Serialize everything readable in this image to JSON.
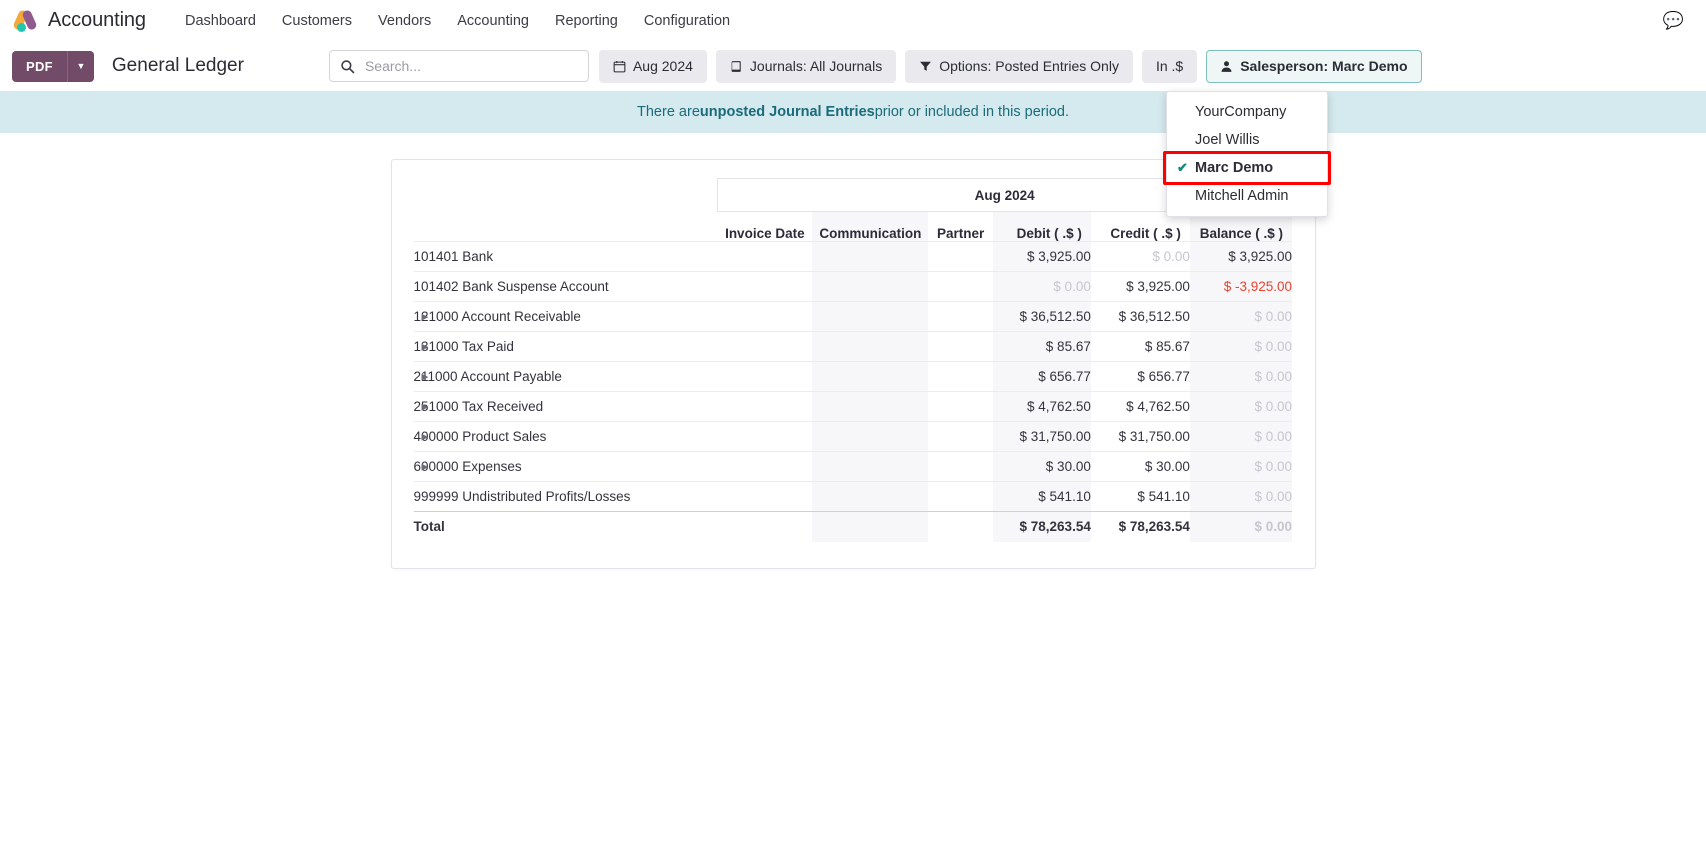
{
  "navbar": {
    "brand": "Accounting",
    "links": [
      "Dashboard",
      "Customers",
      "Vendors",
      "Accounting",
      "Reporting",
      "Configuration"
    ],
    "right_icons": [
      "chat-icon"
    ]
  },
  "toolbar": {
    "pdf_label": "PDF",
    "report_title": "General Ledger",
    "search_placeholder": "Search...",
    "search_value": "",
    "filters": [
      {
        "label": "Aug 2024",
        "icon": "calendar-icon",
        "active": false
      },
      {
        "label": "Journals: All Journals",
        "icon": "book-icon",
        "active": false
      },
      {
        "label": "Options: Posted Entries Only",
        "icon": "funnel-icon",
        "active": false
      },
      {
        "label": "In .$",
        "icon": "",
        "active": false
      },
      {
        "label": "Salesperson: Marc Demo",
        "icon": "person-icon",
        "active": true
      }
    ]
  },
  "dropdown": {
    "items": [
      {
        "label": "YourCompany",
        "selected": false,
        "highlighted": false
      },
      {
        "label": "Joel Willis",
        "selected": false,
        "highlighted": false
      },
      {
        "label": "Marc Demo",
        "selected": true,
        "highlighted": true
      },
      {
        "label": "Mitchell Admin",
        "selected": false,
        "highlighted": false
      }
    ],
    "highlight_color": "#ff0000",
    "check_glyph": "✔"
  },
  "alert": {
    "prefix": "There are ",
    "bold": "unposted Journal Entries",
    "suffix": " prior or included in this period."
  },
  "report": {
    "period_label": "Aug 2024",
    "columns": [
      "Invoice Date",
      "Communication",
      "Partner",
      "Debit ( .$ )",
      "Credit ( .$ )",
      "Balance ( .$ )"
    ],
    "rows": [
      {
        "name": "101401 Bank",
        "expandable": false,
        "invoice_date": "",
        "communication": "",
        "partner": "",
        "debit": "$ 3,925.00",
        "credit": "$ 0.00",
        "balance": "$ 3,925.00",
        "debit_muted": false,
        "credit_muted": true,
        "balance_muted": false,
        "balance_negative": false
      },
      {
        "name": "101402 Bank Suspense Account",
        "expandable": false,
        "invoice_date": "",
        "communication": "",
        "partner": "",
        "debit": "$ 0.00",
        "credit": "$ 3,925.00",
        "balance": "$ -3,925.00",
        "debit_muted": true,
        "credit_muted": false,
        "balance_muted": false,
        "balance_negative": true
      },
      {
        "name": "121000 Account Receivable",
        "expandable": true,
        "invoice_date": "",
        "communication": "",
        "partner": "",
        "debit": "$ 36,512.50",
        "credit": "$ 36,512.50",
        "balance": "$ 0.00",
        "debit_muted": false,
        "credit_muted": false,
        "balance_muted": true,
        "balance_negative": false
      },
      {
        "name": "131000 Tax Paid",
        "expandable": true,
        "invoice_date": "",
        "communication": "",
        "partner": "",
        "debit": "$ 85.67",
        "credit": "$ 85.67",
        "balance": "$ 0.00",
        "debit_muted": false,
        "credit_muted": false,
        "balance_muted": true,
        "balance_negative": false
      },
      {
        "name": "211000 Account Payable",
        "expandable": true,
        "invoice_date": "",
        "communication": "",
        "partner": "",
        "debit": "$ 656.77",
        "credit": "$ 656.77",
        "balance": "$ 0.00",
        "debit_muted": false,
        "credit_muted": false,
        "balance_muted": true,
        "balance_negative": false
      },
      {
        "name": "251000 Tax Received",
        "expandable": true,
        "invoice_date": "",
        "communication": "",
        "partner": "",
        "debit": "$ 4,762.50",
        "credit": "$ 4,762.50",
        "balance": "$ 0.00",
        "debit_muted": false,
        "credit_muted": false,
        "balance_muted": true,
        "balance_negative": false
      },
      {
        "name": "400000 Product Sales",
        "expandable": true,
        "invoice_date": "",
        "communication": "",
        "partner": "",
        "debit": "$ 31,750.00",
        "credit": "$ 31,750.00",
        "balance": "$ 0.00",
        "debit_muted": false,
        "credit_muted": false,
        "balance_muted": true,
        "balance_negative": false
      },
      {
        "name": "600000 Expenses",
        "expandable": true,
        "invoice_date": "",
        "communication": "",
        "partner": "",
        "debit": "$ 30.00",
        "credit": "$ 30.00",
        "balance": "$ 0.00",
        "debit_muted": false,
        "credit_muted": false,
        "balance_muted": true,
        "balance_negative": false
      },
      {
        "name": "999999 Undistributed Profits/Losses",
        "expandable": false,
        "invoice_date": "",
        "communication": "",
        "partner": "",
        "debit": "$ 541.10",
        "credit": "$ 541.10",
        "balance": "$ 0.00",
        "debit_muted": false,
        "credit_muted": false,
        "balance_muted": true,
        "balance_negative": false
      }
    ],
    "total": {
      "name": "Total",
      "debit": "$ 78,263.54",
      "credit": "$ 78,263.54",
      "balance": "$ 0.00",
      "balance_muted": true
    }
  }
}
